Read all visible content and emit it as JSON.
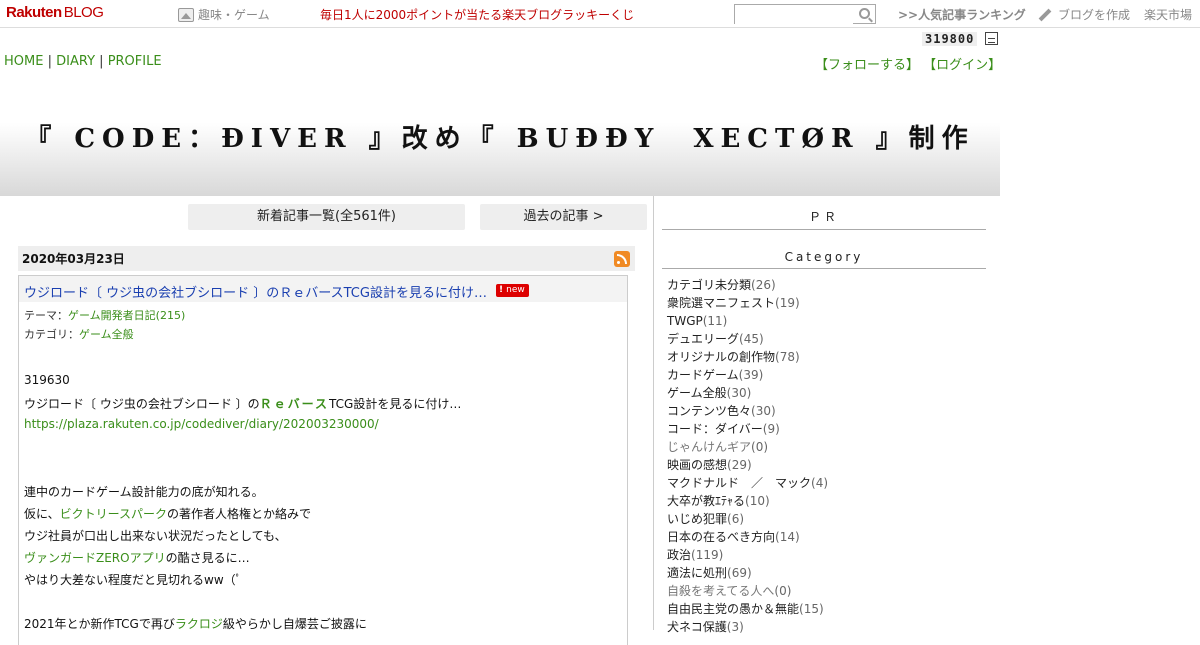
{
  "topbar": {
    "logo": "Rakuten",
    "logo_sub": "BLOG",
    "genre": "趣味・ゲーム",
    "lucky": "毎日1人に2000ポイントが当たる楽天ブログラッキーくじ",
    "search_placeholder": "",
    "ranking": ">>人気記事ランキング",
    "create": "ブログを作成",
    "ichiba": "楽天市場"
  },
  "counter": "319800",
  "nav": {
    "home": "HOME",
    "diary": "DIARY",
    "profile": "PROFILE",
    "sep": "|"
  },
  "follow": {
    "follow": "【フォローする】",
    "login": "【ログイン】"
  },
  "header": {
    "title": "『 CODE：ĐIVER 』改め『 BUĐĐY　XECTØR 』制作"
  },
  "buttons": {
    "new_list": "新着記事一覧(全561件)",
    "past": "過去の記事 >"
  },
  "article": {
    "date": "2020年03月23日",
    "title": "ウジロード〔 ウジ虫の会社ブシロード 〕のＲｅバースTCG設計を見るに付け…",
    "badge": "new",
    "theme_label": "テーマ：",
    "theme": "ゲーム開発者日記(215)",
    "category_label": "カテゴリ：",
    "category": "ゲーム全般",
    "counter": "319630",
    "line1_a": "ウジロード〔 ウジ虫の会社ブシロード 〕の",
    "line1_hl": "Ｒｅバース",
    "line1_b": "TCG設計を見るに付け…",
    "url": "https://plaza.rakuten.co.jp/codediver/diary/202003230000/",
    "p1": "連中のカードゲーム設計能力の底が知れる。",
    "p2_a": "仮に、",
    "p2_hl": "ビクトリースパーク",
    "p2_b": "の著作者人格権とか絡みで",
    "p3": "ウジ社員が口出し出来ない状況だったとしても、",
    "p4_hl": "ヴァンガードZEROアプリ",
    "p4_b": "の酷さ見るに…",
    "p5": "やはり大差ない程度だと見切れるww（ﾟ",
    "p6_a": "2021年とか新作TCGで再び",
    "p6_hl": "ラクロジ",
    "p6_b": "級やらかし自爆芸ご披露に"
  },
  "sidebar": {
    "pr": "ＰＲ",
    "category_head": "Category",
    "categories": [
      {
        "label": "カテゴリ未分類",
        "count": "(26)"
      },
      {
        "label": "衆院選マニフェスト",
        "count": "(19)"
      },
      {
        "label": "TWGP",
        "count": "(11)"
      },
      {
        "label": "デュエリーグ",
        "count": "(45)"
      },
      {
        "label": "オリジナルの創作物",
        "count": "(78)"
      },
      {
        "label": "カードゲーム",
        "count": "(39)"
      },
      {
        "label": "ゲーム全般",
        "count": "(30)"
      },
      {
        "label": "コンテンツ色々",
        "count": "(30)"
      },
      {
        "label": "コード：ダイバー",
        "count": "(9)"
      },
      {
        "label": "じゃんけんギア",
        "count": "(0)"
      },
      {
        "label": "映画の感想",
        "count": "(29)"
      },
      {
        "label": "マクドナルド　／　マック",
        "count": "(4)"
      },
      {
        "label": "大卒が教ｴﾃｬる",
        "count": "(10)"
      },
      {
        "label": "いじめ犯罪",
        "count": "(6)"
      },
      {
        "label": "日本の在るべき方向",
        "count": "(14)"
      },
      {
        "label": "政治",
        "count": "(119)"
      },
      {
        "label": "適法に処刑",
        "count": "(69)"
      },
      {
        "label": "自殺を考えてる人へ",
        "count": "(0)"
      },
      {
        "label": "自由民主党の愚か＆無能",
        "count": "(15)"
      },
      {
        "label": "犬ネコ保護",
        "count": "(3)"
      }
    ]
  }
}
